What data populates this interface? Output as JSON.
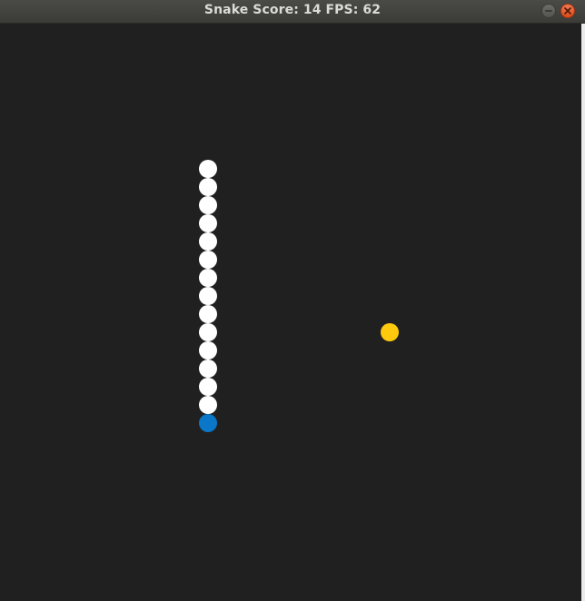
{
  "window": {
    "title": "Snake Score: 14 FPS: 62",
    "minimize_label": "minimize",
    "close_label": "close"
  },
  "game": {
    "score": 14,
    "fps": 62,
    "grid": {
      "columns": 32,
      "cell": 20
    },
    "colors": {
      "background": "#202020",
      "snake_body": "#ffffff",
      "snake_head": "#0a77c8",
      "food": "#ffc90e"
    },
    "snake": {
      "head": {
        "col": 11,
        "row": 22
      },
      "body": [
        {
          "col": 11,
          "row": 21
        },
        {
          "col": 11,
          "row": 20
        },
        {
          "col": 11,
          "row": 19
        },
        {
          "col": 11,
          "row": 18
        },
        {
          "col": 11,
          "row": 17
        },
        {
          "col": 11,
          "row": 16
        },
        {
          "col": 11,
          "row": 15
        },
        {
          "col": 11,
          "row": 14
        },
        {
          "col": 11,
          "row": 13
        },
        {
          "col": 11,
          "row": 12
        },
        {
          "col": 11,
          "row": 11
        },
        {
          "col": 11,
          "row": 10
        },
        {
          "col": 11,
          "row": 9
        },
        {
          "col": 11,
          "row": 8
        }
      ]
    },
    "food": {
      "col": 21,
      "row": 17
    }
  }
}
